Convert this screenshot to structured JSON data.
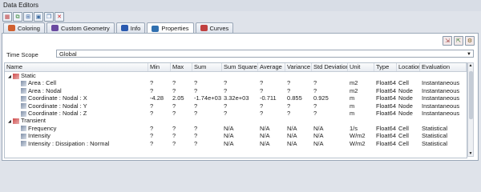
{
  "window": {
    "title": "Data Editors"
  },
  "toolbar": {
    "buttons": [
      {
        "name": "calc-icon",
        "glyph": "▦",
        "color": "#c04040"
      },
      {
        "name": "copy-icon",
        "glyph": "⧉",
        "color": "#3a8a3a"
      },
      {
        "name": "tree-icon",
        "glyph": "⊞",
        "color": "#2a5a9a"
      },
      {
        "name": "window-icon",
        "glyph": "▣",
        "color": "#3a6aa0"
      },
      {
        "name": "duplicate-icon",
        "glyph": "❐",
        "color": "#3a6aa0"
      },
      {
        "name": "delete-icon",
        "glyph": "✕",
        "color": "#cc2222"
      }
    ]
  },
  "tabs": [
    {
      "label": "Coloring",
      "active": false
    },
    {
      "label": "Custom Geometry",
      "active": false
    },
    {
      "label": "Info",
      "active": false
    },
    {
      "label": "Properties",
      "active": true
    },
    {
      "label": "Curves",
      "active": false
    }
  ],
  "time_scope": {
    "label": "Time Scope",
    "value": "Global"
  },
  "columns": [
    "Name",
    "Min",
    "Max",
    "Sum",
    "Sum Squared",
    "Average",
    "Variance",
    "Std Deviation",
    "Unit",
    "Type",
    "Location",
    "Evaluation"
  ],
  "groups": [
    {
      "label": "Static",
      "rows": [
        {
          "name": "Area : Cell",
          "values": [
            "?",
            "?",
            "?",
            "?",
            "?",
            "?",
            "?",
            "m2",
            "Float64",
            "Cell",
            "Instantaneous"
          ]
        },
        {
          "name": "Area : Nodal",
          "values": [
            "?",
            "?",
            "?",
            "?",
            "?",
            "?",
            "?",
            "m2",
            "Float64",
            "Node",
            "Instantaneous"
          ]
        },
        {
          "name": "Coordinate : Nodal : X",
          "values": [
            "-4.28",
            "2.05",
            "-1.74e+03",
            "3.32e+03",
            "-0.711",
            "0.855",
            "0.925",
            "m",
            "Float64",
            "Node",
            "Instantaneous"
          ]
        },
        {
          "name": "Coordinate : Nodal : Y",
          "values": [
            "?",
            "?",
            "?",
            "?",
            "?",
            "?",
            "?",
            "m",
            "Float64",
            "Node",
            "Instantaneous"
          ]
        },
        {
          "name": "Coordinate : Nodal : Z",
          "values": [
            "?",
            "?",
            "?",
            "?",
            "?",
            "?",
            "?",
            "m",
            "Float64",
            "Node",
            "Instantaneous"
          ]
        }
      ]
    },
    {
      "label": "Transient",
      "rows": [
        {
          "name": "Frequency",
          "values": [
            "?",
            "?",
            "?",
            "N/A",
            "N/A",
            "N/A",
            "N/A",
            "1/s",
            "Float64",
            "Cell",
            "Statistical"
          ]
        },
        {
          "name": "Intensity",
          "values": [
            "?",
            "?",
            "?",
            "N/A",
            "N/A",
            "N/A",
            "N/A",
            "W/m2",
            "Float64",
            "Cell",
            "Statistical"
          ]
        },
        {
          "name": "Intensity : Dissipation : Normal",
          "values": [
            "?",
            "?",
            "?",
            "N/A",
            "N/A",
            "N/A",
            "N/A",
            "W/m2",
            "Float64",
            "Cell",
            "Statistical"
          ]
        }
      ]
    }
  ],
  "colors": {
    "accent": "#3a6aa0",
    "selection": "#ffffff"
  }
}
